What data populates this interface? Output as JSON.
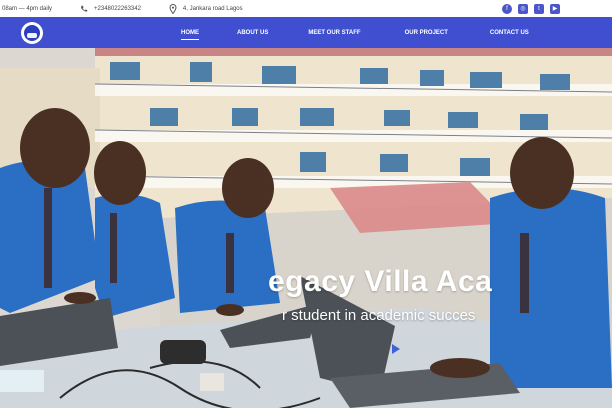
{
  "topbar": {
    "hours": "08am — 4pm daily",
    "phone": "+2348022263342",
    "address": "4, Jankara road Lagos",
    "socials": [
      "facebook-icon",
      "instagram-icon",
      "twitter-icon",
      "youtube-icon"
    ]
  },
  "nav": {
    "items": [
      {
        "label": "HOME",
        "active": true
      },
      {
        "label": "ABOUT US",
        "active": false
      },
      {
        "label": "MEET OUR STAFF",
        "active": false
      },
      {
        "label": "OUR PROJECT",
        "active": false
      },
      {
        "label": "CONTACT US",
        "active": false
      }
    ]
  },
  "hero": {
    "title": "egacy Villa Aca",
    "subtitle": "r student in academic succes"
  },
  "colors": {
    "nav_bg": "#3f4fd0",
    "accent": "#4a56c9",
    "uniform_blue": "#2b6fc4",
    "building_cream": "#efe5cf",
    "roof_red": "#c98585"
  }
}
